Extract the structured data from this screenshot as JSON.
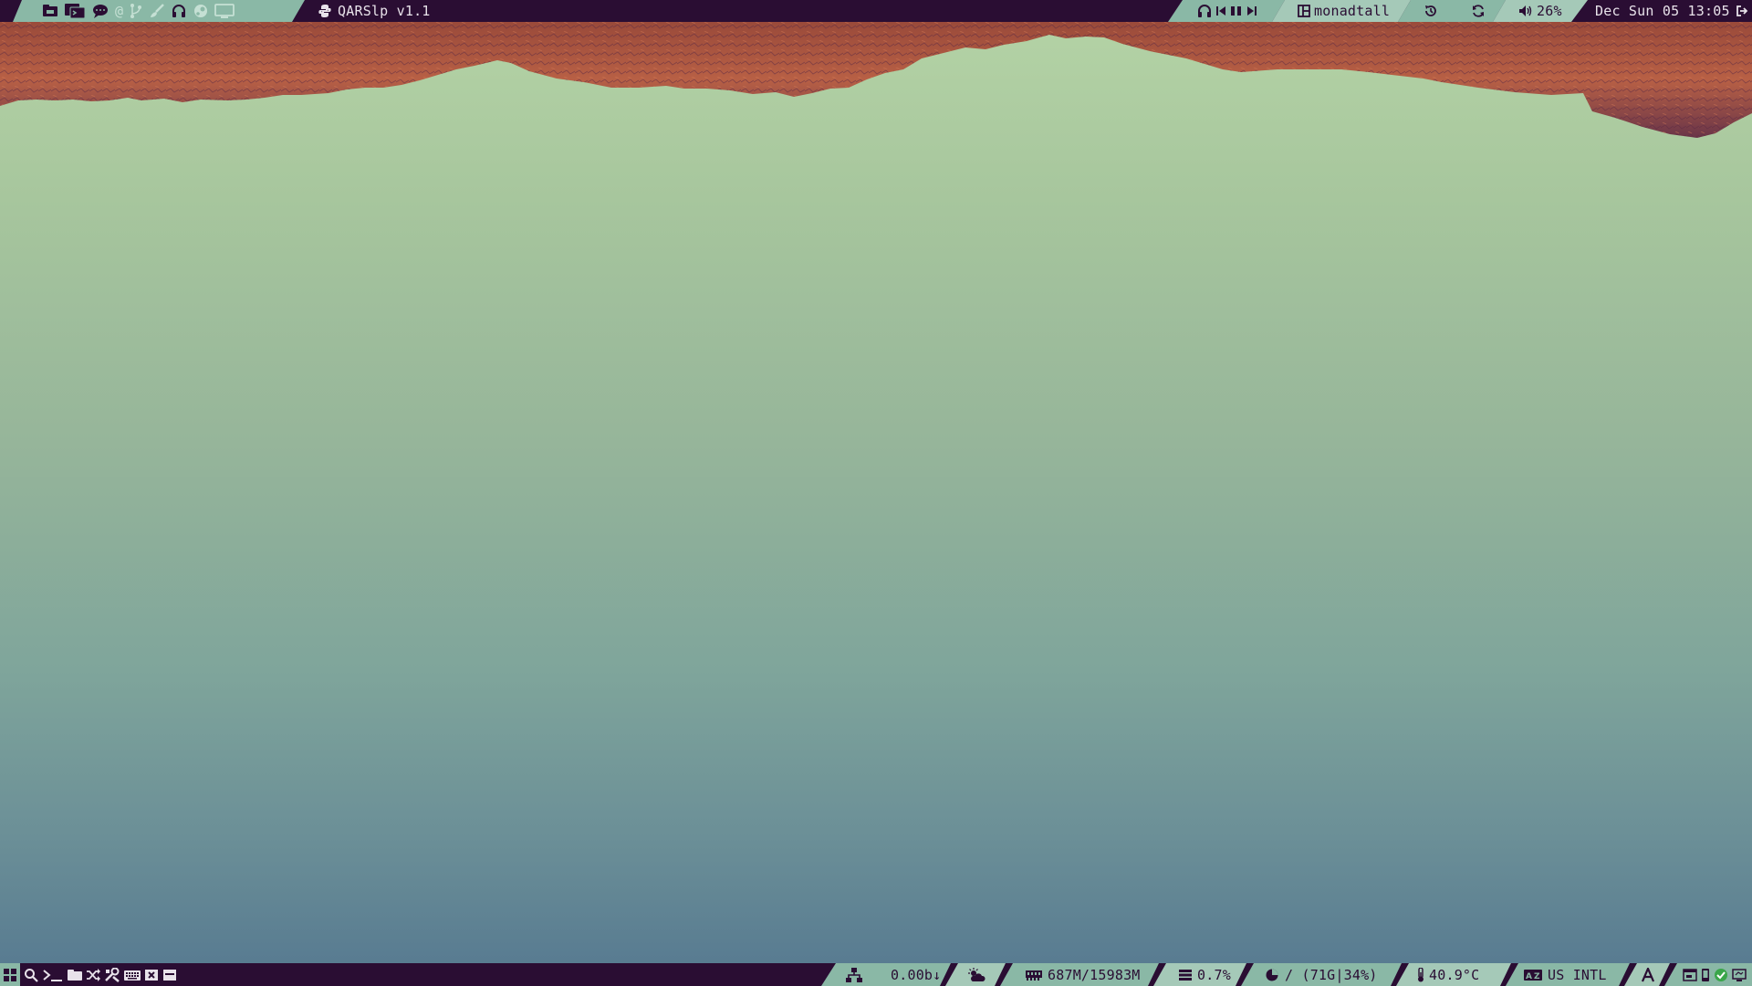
{
  "top_bar": {
    "launchers": [
      "folder-icon",
      "terminal-icon",
      "chat-icon",
      "at-icon",
      "git-branch-icon",
      "paintbrush-icon",
      "headphones-icon",
      "steam-icon",
      "monitor-icon"
    ],
    "window_title": "QARSlp v1.1",
    "window_title_icon": "python-icon",
    "media": [
      "headphones-icon",
      "previous-icon",
      "pause-icon",
      "next-icon"
    ],
    "layout_icon": "layout-icon",
    "layout_name": "monadtall",
    "history_icon": "history-icon",
    "refresh_icon": "refresh-icon",
    "volume_icon": "volume-icon",
    "volume": "26%",
    "clock": "Dec Sun 05 13:05",
    "logout_icon": "logout-icon"
  },
  "bottom_bar": {
    "menu_icon": "grid-menu-icon",
    "tools": [
      "search-icon",
      "terminal-prompt-icon",
      "folder-icon",
      "shuffle-icon",
      "settings-tools-icon",
      "keyboard-icon",
      "close-box-icon",
      "window-icon"
    ],
    "network_icon": "network-icon",
    "network_speed": "0.00b↓",
    "weather_icon": "cloud-sun-icon",
    "memory_icon": "memory-icon",
    "memory": "687M/15983M",
    "cpu_icon": "cpu-icon",
    "cpu": "0.7%",
    "disk_icon": "disk-pie-icon",
    "disk": "/ (71G|34%)",
    "temp_icon": "thermometer-icon",
    "temperature": "40.9°C",
    "keyboard_icon": "keyboard-layout-icon",
    "keyboard_layout": "US INTL",
    "font_icon": "font-a-icon",
    "systray": [
      "tray-window-icon",
      "tray-phone-icon",
      "tray-check-icon",
      "tray-screen-icon"
    ]
  },
  "colors": {
    "bar_bg": "#2a0d33",
    "segment_teal": "#8ab8a6",
    "mountain": "#b0573f"
  }
}
